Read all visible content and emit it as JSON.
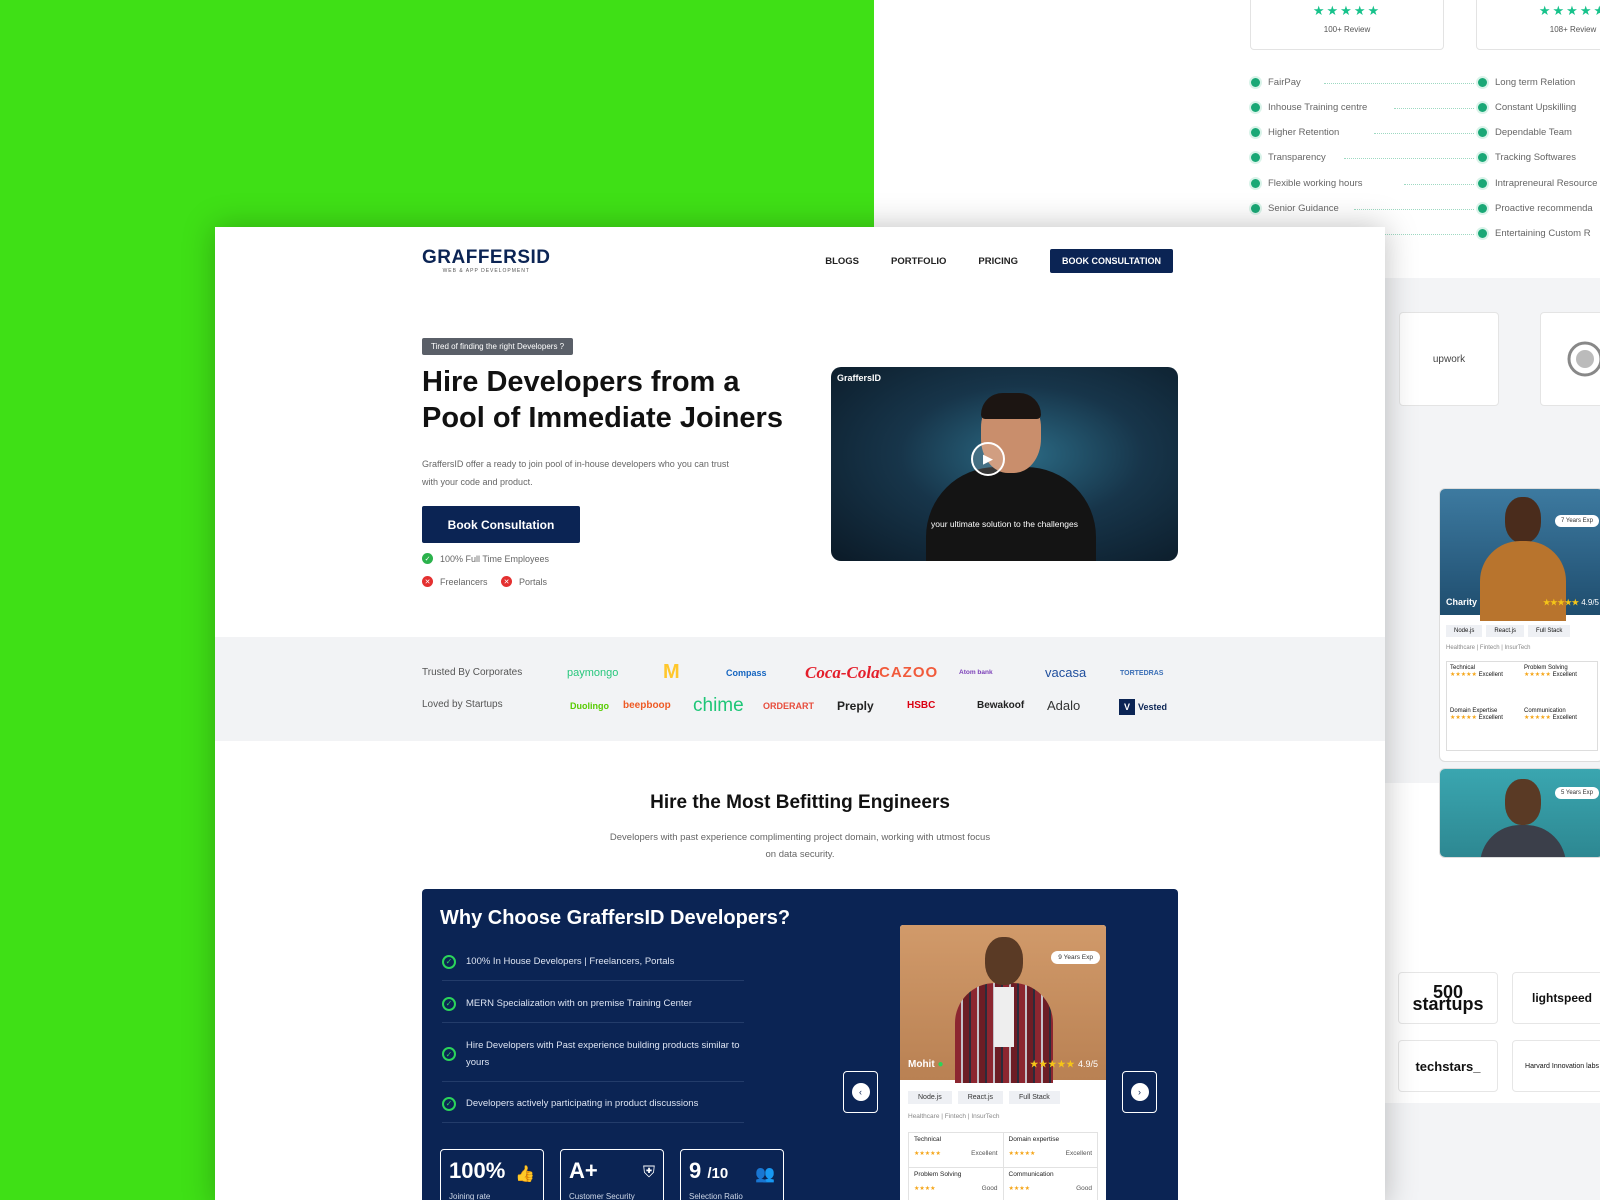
{
  "back_page": {
    "reviews": [
      "100+ Review",
      "108+ Review"
    ],
    "features_left": [
      "FairPay",
      "Inhouse Training centre",
      "Higher Retention",
      "Transparency",
      "Flexible working hours",
      "Senior Guidance"
    ],
    "features_right": [
      "Long term Relation",
      "Constant Upskilling",
      "Dependable Team",
      "Tracking Softwares",
      "Intrapreneural Resource",
      "Proactive recommenda",
      "Entertaining Custom R"
    ],
    "badge_upwork": "upwork",
    "card_charity": {
      "name": "Charity",
      "rating": "4.9/5",
      "exp": "7 Years Exp",
      "skills": [
        "Node.js",
        "React.js",
        "Full Stack"
      ],
      "domains": "Healthcare  |  Fintech  |  InsurTech"
    },
    "card_second": {
      "exp": "5 Years Exp"
    },
    "score_labels": [
      "Technical",
      "Problem Solving",
      "Domain Expertise",
      "Communication"
    ],
    "score_value": "Excellent",
    "startups": [
      "500 startups",
      "lightspeed",
      "techstars_",
      "Harvard Innovation labs"
    ]
  },
  "nav": {
    "brand": "GRAFFERSID",
    "brand_sub": "WEB & APP DEVELOPMENT",
    "items": [
      "BLOGS",
      "PORTFOLIO",
      "PRICING"
    ],
    "cta": "BOOK CONSULTATION"
  },
  "hero": {
    "tag": "Tired of finding the right Developers ?",
    "title": "Hire Developers from a Pool of Immediate Joiners",
    "desc": "GraffersID offer a ready to join pool of in-house developers who you can trust with your code and product.",
    "button": "Book Consultation",
    "check_yes": "100% Full Time Employees",
    "check_no_1": "Freelancers",
    "check_no_2": "Portals",
    "video_logo": "GraffersID",
    "video_caption": "your ultimate solution to the challenges"
  },
  "trusted": {
    "label_corporates": "Trusted By Corporates",
    "label_startups": "Loved by Startups",
    "corporates": [
      "paymongo",
      "McDonald's",
      "Compass",
      "Coca-Cola",
      "CAZOO",
      "Atom bank",
      "vacasa",
      "TORTEDRAS"
    ],
    "startups": [
      "Duolingo",
      "beepboop",
      "chime",
      "ORDERART",
      "Preply",
      "HSBC",
      "Bewakoof",
      "Adalo",
      "Vested"
    ]
  },
  "section": {
    "title": "Hire the Most Befitting Engineers",
    "desc": "Developers with past experience complimenting project domain, working with utmost focus on data security."
  },
  "why": {
    "title": "Why Choose GraffersID Developers?",
    "items": [
      "100% In House Developers | Freelancers, Portals",
      "MERN Specialization with on premise Training Center",
      "Hire Developers with Past experience building products similar to yours",
      "Developers actively participating in product discussions"
    ],
    "stats": [
      {
        "value": "100%",
        "label": "Joining rate"
      },
      {
        "value": "A+",
        "label": "Customer Security"
      },
      {
        "value": "9",
        "value_sub": "/10",
        "label": "Selection Ratio"
      }
    ],
    "dev": {
      "name": "Mohit",
      "rating": "4.9/5",
      "exp": "9 Years Exp",
      "skills": [
        "Node.js",
        "React.js",
        "Full Stack"
      ],
      "domains": "Healthcare  |  Fintech  |  InsurTech",
      "scores": [
        {
          "label": "Technical",
          "value": "Excellent"
        },
        {
          "label": "Domain expertise",
          "value": "Excellent"
        },
        {
          "label": "Problem Solving",
          "value": "Good"
        },
        {
          "label": "Communication",
          "value": "Good"
        }
      ]
    }
  }
}
